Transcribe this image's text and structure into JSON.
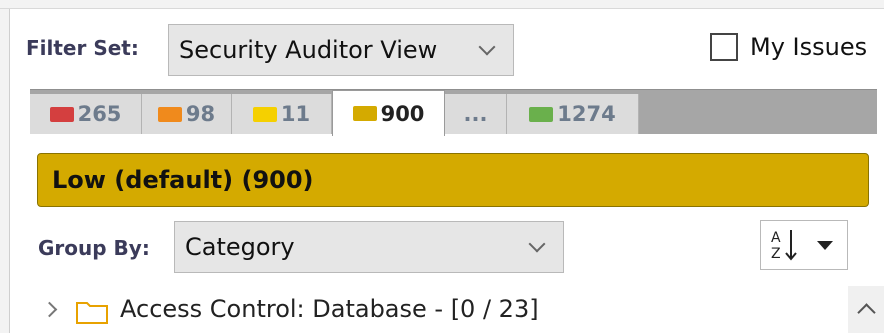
{
  "filter": {
    "label": "Filter Set:",
    "value": "Security Auditor View"
  },
  "my_issues": {
    "label": "My Issues",
    "checked": false
  },
  "tabs": [
    {
      "count": "265",
      "color": "#d43f3f",
      "active": false
    },
    {
      "count": "98",
      "color": "#f08a1c",
      "active": false
    },
    {
      "count": "11",
      "color": "#f5d000",
      "active": false
    },
    {
      "count": "900",
      "color": "#d4aa00",
      "active": true
    },
    {
      "count": "...",
      "color": "",
      "active": false
    },
    {
      "count": "1274",
      "color": "#6ab04c",
      "active": false
    }
  ],
  "banner": {
    "text": "Low (default) (900)",
    "color": "#d4aa00"
  },
  "group_by": {
    "label": "Group By:",
    "value": "Category"
  },
  "sort": {
    "icon": "sort-az-icon"
  },
  "tree": [
    {
      "label": "Access Control: Database - [0 / 23]",
      "icon": "folder-icon",
      "expanded": false
    }
  ]
}
